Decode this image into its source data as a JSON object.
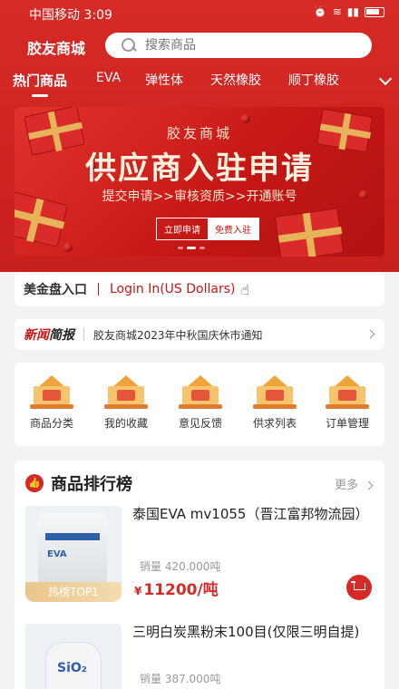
{
  "status_bar": {
    "carrier_time": "中国移动 3:09",
    "icons": [
      "alarm-icon",
      "wifi-icon",
      "signal-icon",
      "battery-icon"
    ]
  },
  "header": {
    "app_title": "胶友商城",
    "search_placeholder": "搜索商品"
  },
  "tabs": [
    {
      "label": "热门商品",
      "active": true
    },
    {
      "label": "EVA",
      "active": false
    },
    {
      "label": "弹性体",
      "active": false
    },
    {
      "label": "天然橡胶",
      "active": false
    },
    {
      "label": "顺丁橡胶",
      "active": false
    }
  ],
  "banner": {
    "subtitle": "胶友商城",
    "title": "供应商入驻申请",
    "steps": "提交申请>>审核资质>>开通账号",
    "button_apply": "立即申请",
    "button_free": "免费入驻",
    "page_index": 2,
    "page_count": 3
  },
  "gold": {
    "label": "美金盘入口",
    "login": "Login In(US Dollars)"
  },
  "news": {
    "logo_part1": "新闻",
    "logo_part2": "简报",
    "text": "胶友商城2023年中秋国庆休市通知"
  },
  "menu": [
    {
      "label": "商品分类",
      "icon": "category-icon"
    },
    {
      "label": "我的收藏",
      "icon": "favorites-icon"
    },
    {
      "label": "意见反馈",
      "icon": "feedback-icon"
    },
    {
      "label": "供求列表",
      "icon": "supply-list-icon"
    },
    {
      "label": "订单管理",
      "icon": "order-icon"
    }
  ],
  "ranking": {
    "title": "商品排行榜",
    "more": "更多",
    "products": [
      {
        "name": "泰国EVA mv1055（晋江富邦物流园）",
        "sold": "销量 420.000吨",
        "price_symbol": "¥",
        "price": "11200/吨",
        "badge": "热榜TOP1",
        "image_text": "EVA"
      },
      {
        "name": "三明白炭黑粉末100目(仅限三明自提)",
        "sold": "销量 387.000吨",
        "image_text": "SiO₂"
      }
    ]
  },
  "colors": {
    "brand_red": "#d62a26",
    "price_red": "#d62a26",
    "badge_gold": "#e9c58b"
  }
}
